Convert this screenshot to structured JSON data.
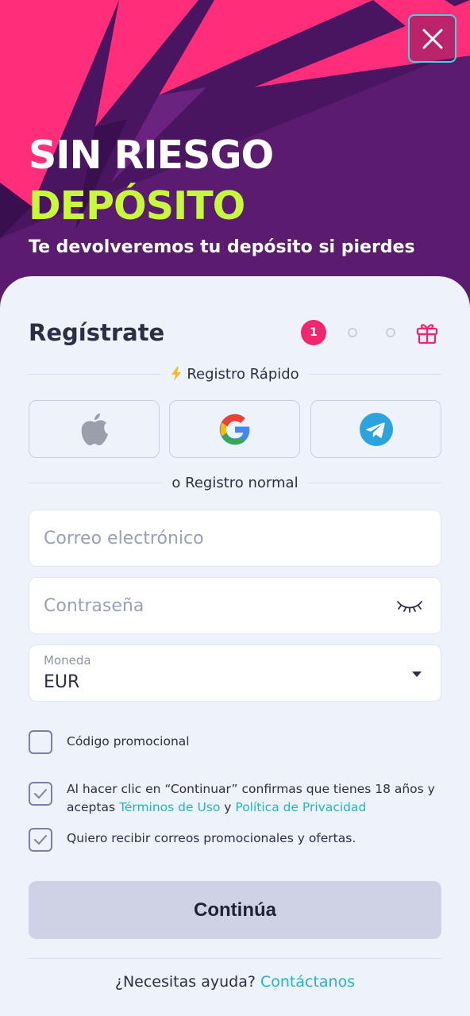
{
  "hero": {
    "title_line1": "SIN RIESGO",
    "title_line2": "DEPÓSITO",
    "subtitle": "Te devolveremos tu depósito si pierdes",
    "close_icon": "close-icon"
  },
  "register": {
    "title": "Regístrate",
    "steps": {
      "active": "1",
      "total": 3
    }
  },
  "quick": {
    "label": "Registro Rápido",
    "icon": "lightning-icon",
    "providers": [
      "apple",
      "google",
      "telegram"
    ]
  },
  "normal": {
    "label": "o Registro normal"
  },
  "form": {
    "email_placeholder": "Correo electrónico",
    "password_placeholder": "Contraseña",
    "currency_label": "Moneda",
    "currency_value": "EUR"
  },
  "checks": {
    "promo_label": "Código promocional",
    "promo_checked": false,
    "terms_prefix": "Al hacer clic en “Continuar” confirmas que tienes 18 años y aceptas ",
    "terms_link": "Términos de Uso",
    "terms_and": " y ",
    "privacy_link": "Política de Privacidad",
    "terms_checked": true,
    "newsletter_label": "Quiero recibir correos promocionales y ofertas.",
    "newsletter_checked": true
  },
  "continue_label": "Continúa",
  "footer": {
    "help_text": "¿Necesitas ayuda?",
    "contact_link": "Contáctanos"
  },
  "colors": {
    "accent_pink": "#f2256f",
    "accent_lime": "#c6f93a",
    "link": "#1fb6c4",
    "hero_purple": "#5a1a6e"
  }
}
